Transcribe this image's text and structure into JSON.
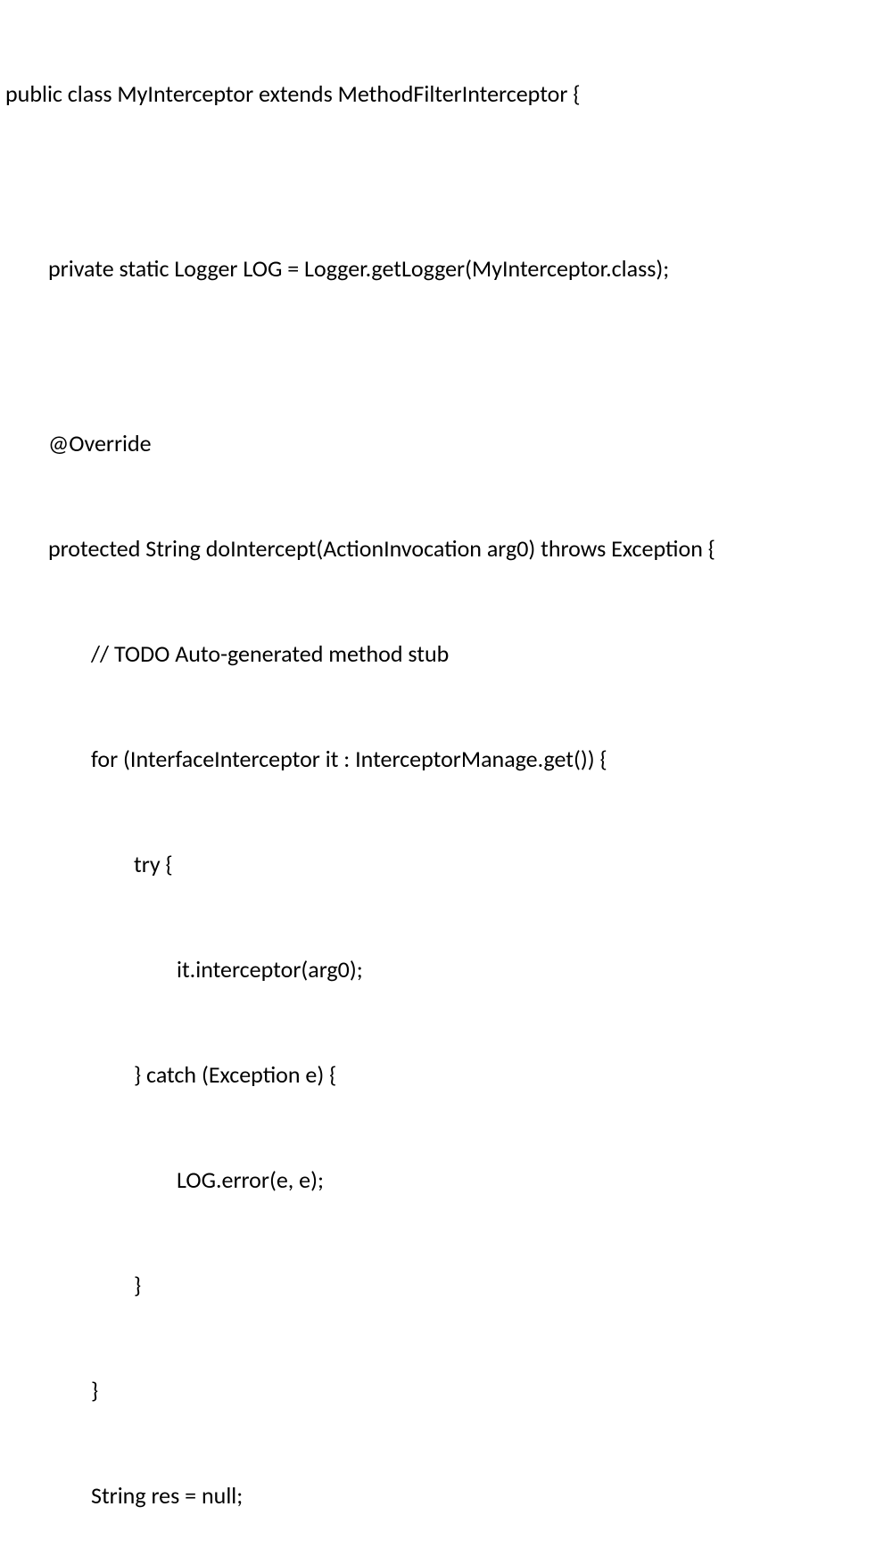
{
  "code": {
    "lines": [
      "public class MyInterceptor extends MethodFilterInterceptor {",
      "",
      "",
      "private static Logger LOG = Logger.getLogger(MyInterceptor.class);",
      "",
      "",
      "@Override",
      "protected String doIntercept(ActionInvocation arg0) throws Exception {",
      "// TODO Auto-generated method stub",
      "for (InterfaceInterceptor it : InterceptorManage.get()) {",
      "try {",
      "it.interceptor(arg0);",
      "} catch (Exception e) {",
      "LOG.error(e, e);",
      "}",
      "}",
      "String res = null;"
    ]
  }
}
